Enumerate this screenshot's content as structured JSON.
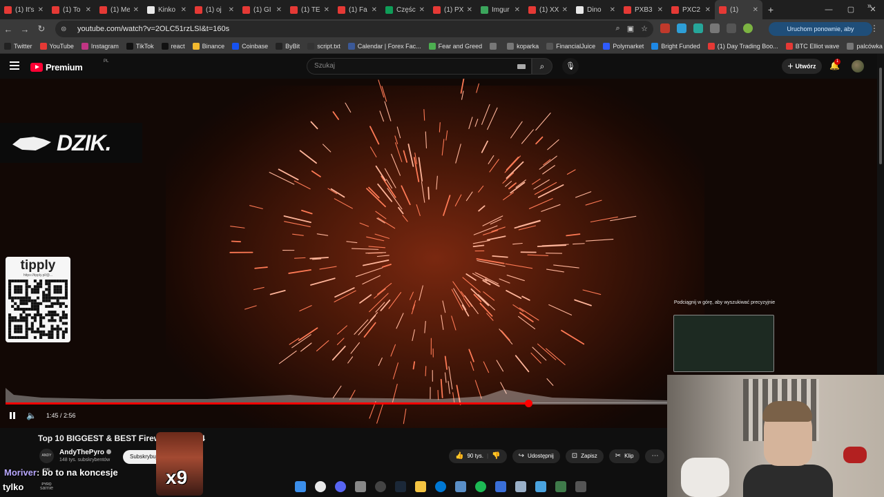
{
  "browser": {
    "tabs": [
      {
        "label": "(1) It's",
        "fav": "red"
      },
      {
        "label": "(1) To",
        "fav": "red"
      },
      {
        "label": "(1) Me",
        "fav": "red"
      },
      {
        "label": "Kinko",
        "fav": "wht"
      },
      {
        "label": "(1) oj",
        "fav": "red"
      },
      {
        "label": "(1) GI",
        "fav": "red"
      },
      {
        "label": "(1) TE",
        "fav": "red"
      },
      {
        "label": "(1) Fa",
        "fav": "red"
      },
      {
        "label": "Częśc",
        "fav": "drk"
      },
      {
        "label": "(1) PX",
        "fav": "red"
      },
      {
        "label": "Imgur",
        "fav": "grn"
      },
      {
        "label": "(1) XX",
        "fav": "red"
      },
      {
        "label": "Dino",
        "fav": "wht"
      },
      {
        "label": "PXB3",
        "fav": "red"
      },
      {
        "label": "PXC2",
        "fav": "red"
      },
      {
        "label": "(1)",
        "fav": "red",
        "active": true
      }
    ],
    "new_tab": "+",
    "window_controls": [
      "—",
      "▢",
      "✕"
    ],
    "url": "youtube.com/watch?v=2OLC51rzLSI&t=160s",
    "update_button": "Uruchom ponownie, aby zaktualizować",
    "bookmarks": [
      {
        "label": "Twitter",
        "color": "#222222"
      },
      {
        "label": "YouTube",
        "color": "#e53935"
      },
      {
        "label": "Instagram",
        "color": "#c13584"
      },
      {
        "label": "TikTok",
        "color": "#111111"
      },
      {
        "label": "react",
        "color": "#111111"
      },
      {
        "label": "Binance",
        "color": "#f3ba2f"
      },
      {
        "label": "Coinbase",
        "color": "#1652f0"
      },
      {
        "label": "ByBit",
        "color": "#222222"
      },
      {
        "label": "script.txt",
        "color": "#333333"
      },
      {
        "label": "Calendar | Forex Fac...",
        "color": "#3b5998"
      },
      {
        "label": "Fear and Greed",
        "color": "#4caf50"
      },
      {
        "label": "",
        "color": "#777777"
      },
      {
        "label": "koparka",
        "color": "#777777"
      },
      {
        "label": "FinancialJuice",
        "color": "#555555"
      },
      {
        "label": "Polymarket",
        "color": "#2e5bff"
      },
      {
        "label": "Bright Funded",
        "color": "#1e88e5"
      },
      {
        "label": "(1) Day Trading Boo...",
        "color": "#e53935"
      },
      {
        "label": "BTC Elliot wave",
        "color": "#e53935"
      },
      {
        "label": "palcówka",
        "color": "#777777"
      }
    ]
  },
  "youtube": {
    "brand": "Premium",
    "country": "PL",
    "search_placeholder": "Szukaj",
    "create_label": "Utwórz",
    "notification_count": "1"
  },
  "player": {
    "overlay_logo": "DZIK.",
    "tipply_logo": "tipply",
    "tipply_url": "https://tipply.pl/@...",
    "scroll_hint": "Podciągnij w górę, aby wyszukiwać precyzyjnie",
    "time": "1:45 / 2:56",
    "progress": 0.79
  },
  "video": {
    "title": "Top 10 BIGGEST & BEST Firewo... 20-2024",
    "channel": "AndyThePyro",
    "channel_avatar_text": "ANDY THE PYRO",
    "subscribers": "148 tys. subskrybentów",
    "subscribe": "Subskrybuj",
    "likes": "90 tys.",
    "share": "Udostępnij",
    "save": "Zapisz",
    "clip": "Klip",
    "sticker_text": "x9"
  },
  "chat": {
    "user": "Moriver",
    "message": ": bo to na koncesje",
    "line2": "tylko",
    "small": "sarnie"
  },
  "colors": {
    "accent_red": "#ff0000",
    "chat_user": "#b9a8ff",
    "update_button": "#1f4e79"
  }
}
